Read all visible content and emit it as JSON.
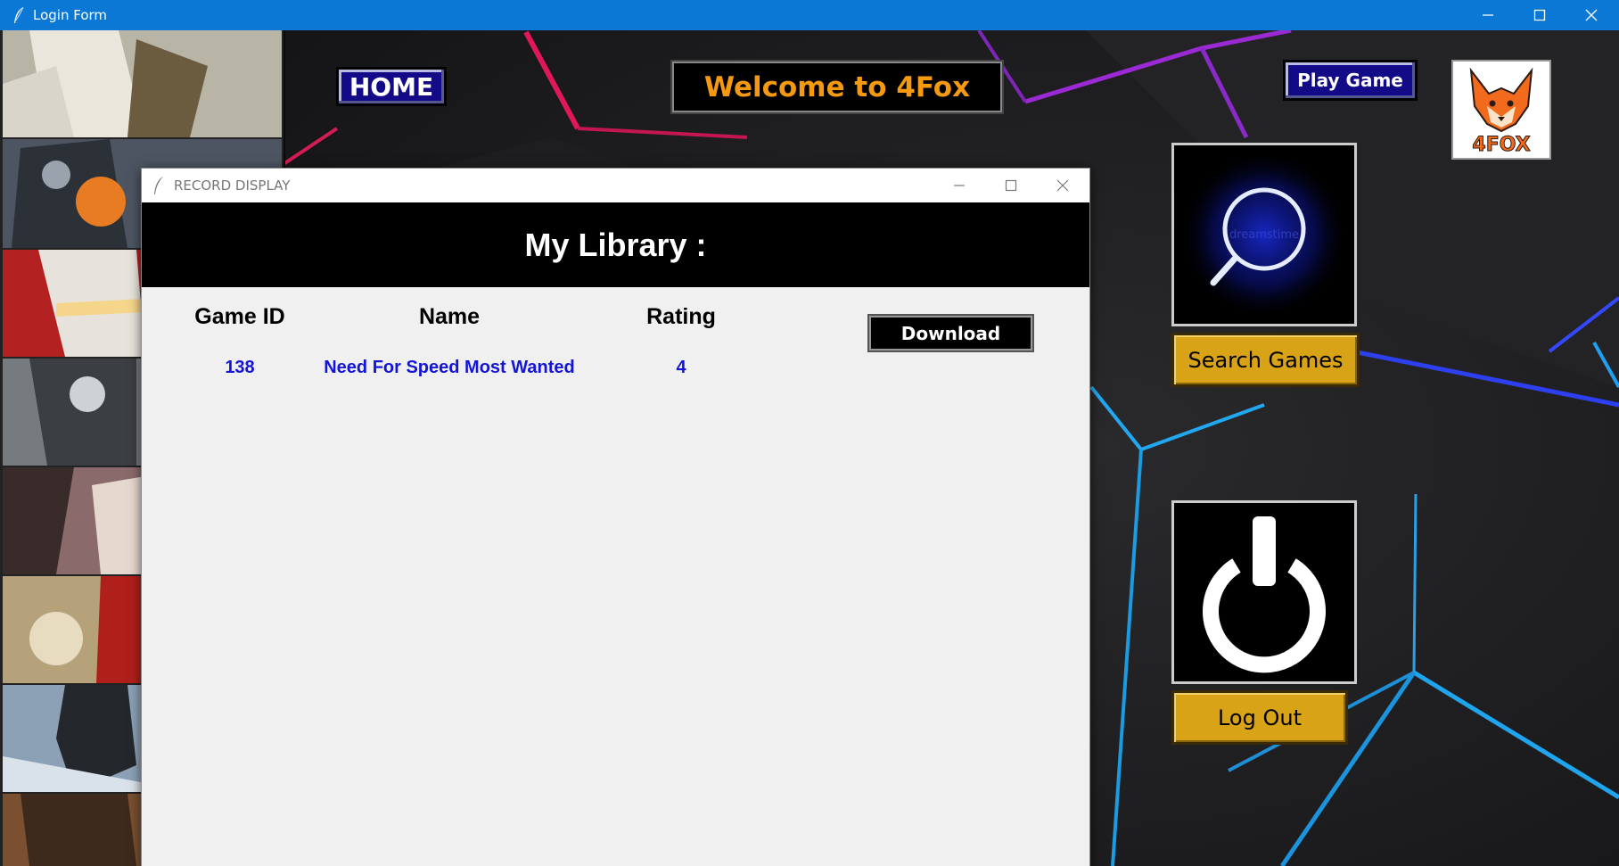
{
  "window": {
    "title": "Login Form"
  },
  "nav": {
    "home_label": "HOME",
    "welcome_text": "Welcome to 4Fox",
    "play_label": "Play Game",
    "logo_text": "4FOX"
  },
  "actions": {
    "search_label": "Search Games",
    "logout_label": "Log Out",
    "search_watermark": "dreamstime"
  },
  "dialog": {
    "title": "RECORD DISPLAY",
    "header": "My Library :",
    "columns": [
      "Game ID",
      "Name",
      "Rating"
    ],
    "rows": [
      {
        "id": "138",
        "name": "Need For Speed Most Wanted",
        "rating": "4"
      }
    ],
    "download_label": "Download"
  },
  "colors": {
    "titlebar": "#0b78d6",
    "nav_button": "#120a87",
    "welcome_text": "#f59a10",
    "gold_button": "#d9a318",
    "record_text": "#1414d8",
    "background": "#1b1b1d"
  }
}
